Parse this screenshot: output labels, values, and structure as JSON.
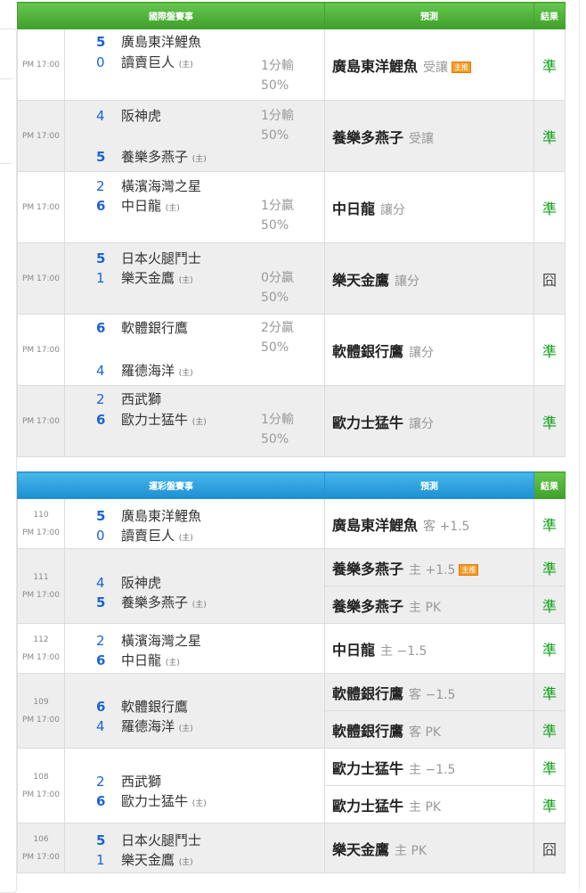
{
  "international": {
    "headers": {
      "match": "國際盤賽事",
      "prediction": "預測",
      "result": "結果"
    },
    "games": [
      {
        "time": "PM 17:00",
        "away": {
          "score": "5",
          "name": "廣島東洋鯉魚",
          "win": true
        },
        "home": {
          "score": "0",
          "name": "讀賣巨人",
          "win": false
        },
        "home_tag": "(主)",
        "odds": [
          "1分輸",
          "50%"
        ],
        "pick": "廣島東洋鯉魚",
        "pick_note": "受讓",
        "badge": "主推",
        "result": "準"
      },
      {
        "time": "PM 17:00",
        "away": {
          "score": "4",
          "name": "阪神虎",
          "win": false
        },
        "home": {
          "score": "5",
          "name": "養樂多燕子",
          "win": true
        },
        "home_tag": "(主)",
        "odds": [
          "1分輸",
          "50%"
        ],
        "pick": "養樂多燕子",
        "pick_note": "受讓",
        "badge": "",
        "result": "準"
      },
      {
        "time": "PM 17:00",
        "away": {
          "score": "2",
          "name": "橫濱海灣之星",
          "win": false
        },
        "home": {
          "score": "6",
          "name": "中日龍",
          "win": true
        },
        "home_tag": "(主)",
        "odds": [
          "1分贏",
          "50%"
        ],
        "pick": "中日龍",
        "pick_note": "讓分",
        "badge": "",
        "result": "準"
      },
      {
        "time": "PM 17:00",
        "away": {
          "score": "5",
          "name": "日本火腿鬥士",
          "win": true
        },
        "home": {
          "score": "1",
          "name": "樂天金鷹",
          "win": false
        },
        "home_tag": "(主)",
        "odds": [
          "0分贏",
          "50%"
        ],
        "pick": "樂天金鷹",
        "pick_note": "讓分",
        "badge": "",
        "result": "囧"
      },
      {
        "time": "PM 17:00",
        "away": {
          "score": "6",
          "name": "軟體銀行鷹",
          "win": true
        },
        "home": {
          "score": "4",
          "name": "羅德海洋",
          "win": false
        },
        "home_tag": "(主)",
        "odds": [
          "2分贏",
          "50%"
        ],
        "pick": "軟體銀行鷹",
        "pick_note": "讓分",
        "badge": "",
        "result": "準"
      },
      {
        "time": "PM 17:00",
        "away": {
          "score": "2",
          "name": "西武獅",
          "win": false
        },
        "home": {
          "score": "6",
          "name": "歐力士猛牛",
          "win": true
        },
        "home_tag": "(主)",
        "odds": [
          "1分輸",
          "50%"
        ],
        "pick": "歐力士猛牛",
        "pick_note": "讓分",
        "badge": "",
        "result": "準"
      }
    ]
  },
  "sportslottery": {
    "headers": {
      "match": "運彩盤賽事",
      "prediction": "預測",
      "result": "結果"
    },
    "games": [
      {
        "no": "110",
        "time": "PM 17:00",
        "away": {
          "score": "5",
          "name": "廣島東洋鯉魚",
          "win": true
        },
        "home": {
          "score": "0",
          "name": "讀賣巨人",
          "win": false
        },
        "home_tag": "(主)",
        "picks": [
          {
            "team": "廣島東洋鯉魚",
            "line": "客 +1.5",
            "badge": "",
            "result": "準"
          }
        ]
      },
      {
        "no": "111",
        "time": "PM 17:00",
        "away": {
          "score": "4",
          "name": "阪神虎",
          "win": false
        },
        "home": {
          "score": "5",
          "name": "養樂多燕子",
          "win": true
        },
        "home_tag": "(主)",
        "picks": [
          {
            "team": "養樂多燕子",
            "line": "主 +1.5",
            "badge": "主推",
            "result": "準"
          },
          {
            "team": "養樂多燕子",
            "line": "主 PK",
            "badge": "",
            "result": "準"
          }
        ]
      },
      {
        "no": "112",
        "time": "PM 17:00",
        "away": {
          "score": "2",
          "name": "橫濱海灣之星",
          "win": false
        },
        "home": {
          "score": "6",
          "name": "中日龍",
          "win": true
        },
        "home_tag": "(主)",
        "picks": [
          {
            "team": "中日龍",
            "line": "主 −1.5",
            "badge": "",
            "result": "準"
          }
        ]
      },
      {
        "no": "109",
        "time": "PM 17:00",
        "away": {
          "score": "6",
          "name": "軟體銀行鷹",
          "win": true
        },
        "home": {
          "score": "4",
          "name": "羅德海洋",
          "win": false
        },
        "home_tag": "(主)",
        "picks": [
          {
            "team": "軟體銀行鷹",
            "line": "客 −1.5",
            "badge": "",
            "result": "準"
          },
          {
            "team": "軟體銀行鷹",
            "line": "客 PK",
            "badge": "",
            "result": "準"
          }
        ]
      },
      {
        "no": "108",
        "time": "PM 17:00",
        "away": {
          "score": "2",
          "name": "西武獅",
          "win": false
        },
        "home": {
          "score": "6",
          "name": "歐力士猛牛",
          "win": true
        },
        "home_tag": "(主)",
        "picks": [
          {
            "team": "歐力士猛牛",
            "line": "主 −1.5",
            "badge": "",
            "result": "準"
          },
          {
            "team": "歐力士猛牛",
            "line": "主 PK",
            "badge": "",
            "result": "準"
          }
        ]
      },
      {
        "no": "106",
        "time": "PM 17:00",
        "away": {
          "score": "5",
          "name": "日本火腿鬥士",
          "win": true
        },
        "home": {
          "score": "1",
          "name": "樂天金鷹",
          "win": false
        },
        "home_tag": "(主)",
        "picks": [
          {
            "team": "樂天金鷹",
            "line": "主 PK",
            "badge": "",
            "result": "囧"
          }
        ]
      }
    ]
  }
}
